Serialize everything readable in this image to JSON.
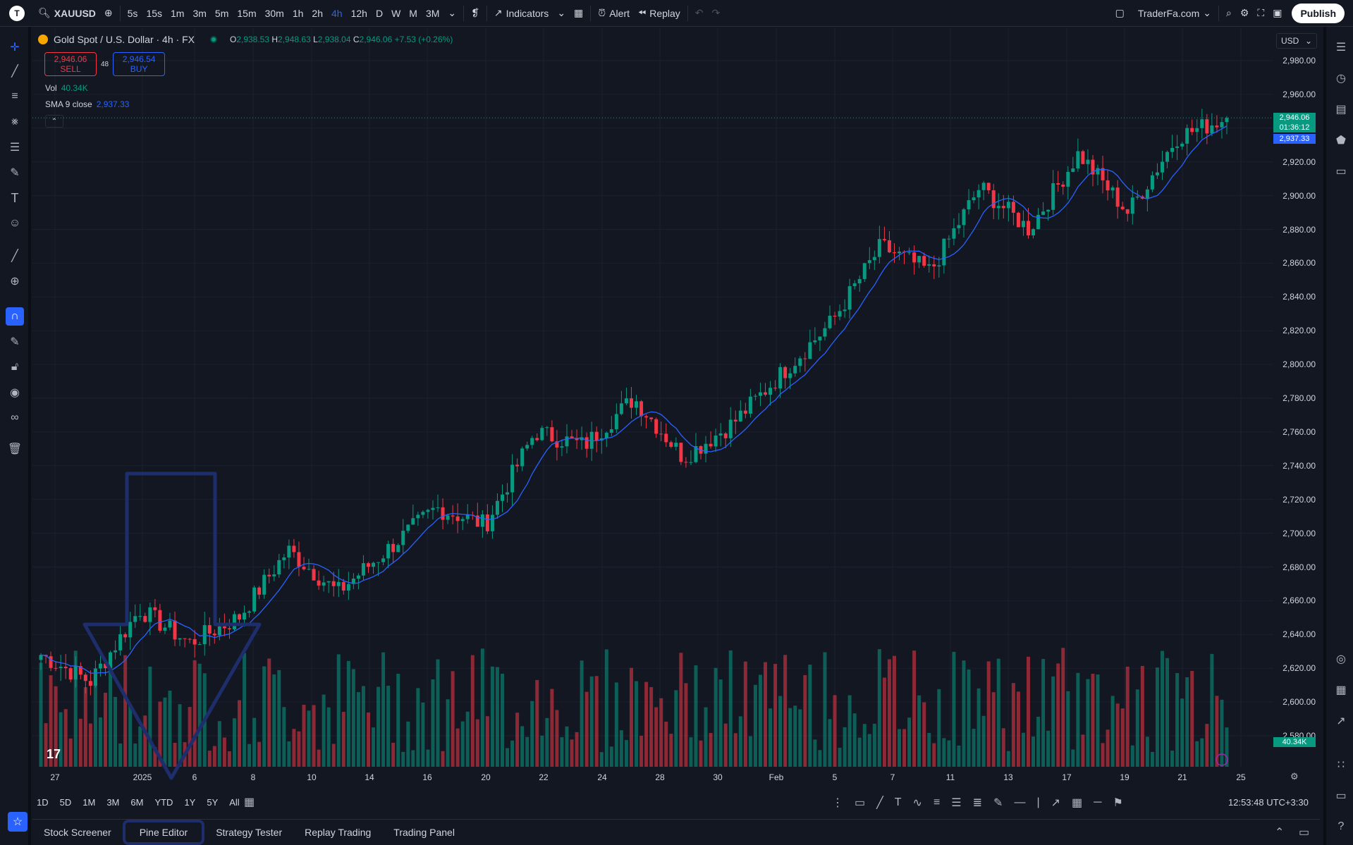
{
  "topbar": {
    "symbol": "XAUUSD",
    "timeframes": [
      "5s",
      "15s",
      "1m",
      "3m",
      "5m",
      "15m",
      "30m",
      "1h",
      "2h",
      "4h",
      "12h",
      "D",
      "W",
      "M",
      "3M"
    ],
    "active_timeframe": "4h",
    "indicators_label": "Indicators",
    "alert_label": "Alert",
    "replay_label": "Replay",
    "layout_name": "TraderFa.com",
    "publish_label": "Publish"
  },
  "legend": {
    "title": "Gold Spot / U.S. Dollar · 4h · FX",
    "o_label": "O",
    "o": "2,938.53",
    "h_label": "H",
    "h": "2,948.63",
    "l_label": "L",
    "l": "2,938.04",
    "c_label": "C",
    "c": "2,946.06",
    "change": "+7.53 (+0.26%)",
    "sell_price": "2,946.06",
    "sell_label": "SELL",
    "spread": "48",
    "buy_price": "2,946.54",
    "buy_label": "BUY",
    "vol_label": "Vol",
    "vol_value": "40.34K",
    "sma_label": "SMA 9 close",
    "sma_value": "2,937.33"
  },
  "price_axis": {
    "currency": "USD",
    "ticks": [
      "2,980.00",
      "2,960.00",
      "2,940.00",
      "2,920.00",
      "2,900.00",
      "2,880.00",
      "2,860.00",
      "2,840.00",
      "2,820.00",
      "2,800.00",
      "2,780.00",
      "2,760.00",
      "2,740.00",
      "2,720.00",
      "2,700.00",
      "2,680.00",
      "2,660.00",
      "2,640.00",
      "2,620.00",
      "2,600.00",
      "2,580.00"
    ],
    "last_price": "2,946.06",
    "countdown": "01:36:12",
    "sma_tag": "2,937.33",
    "vol_tag": "40.34K"
  },
  "time_axis": [
    "27",
    "2025",
    "6",
    "8",
    "10",
    "14",
    "16",
    "20",
    "22",
    "24",
    "28",
    "30",
    "Feb",
    "5",
    "7",
    "11",
    "13",
    "17",
    "19",
    "21",
    "25"
  ],
  "range_bar": [
    "1D",
    "5D",
    "1M",
    "3M",
    "6M",
    "YTD",
    "1Y",
    "5Y",
    "All"
  ],
  "clock": "12:53:48 UTC+3:30",
  "bottom_tabs": [
    "Stock Screener",
    "Pine Editor",
    "Strategy Tester",
    "Replay Trading",
    "Trading Panel"
  ],
  "colors": {
    "up": "#089981",
    "down": "#f23645",
    "sma": "#2962ff",
    "annotation": "#1e2d6b",
    "accent": "#2962ff"
  },
  "chart_data": {
    "type": "candlestick",
    "title": "Gold Spot / U.S. Dollar · 4h · FX",
    "x": [
      "27",
      "2025",
      "6",
      "8",
      "10",
      "14",
      "16",
      "20",
      "22",
      "24",
      "28",
      "30",
      "Feb",
      "5",
      "7",
      "11",
      "13",
      "17",
      "19",
      "21",
      "25"
    ],
    "close": [
      2628,
      2612,
      2655,
      2635,
      2650,
      2690,
      2665,
      2690,
      2715,
      2705,
      2760,
      2752,
      2780,
      2745,
      2765,
      2795,
      2825,
      2870,
      2855,
      2905,
      2880,
      2925,
      2890,
      2935,
      2946
    ],
    "ylim": [
      2570,
      2990
    ],
    "series": [
      {
        "name": "SMA 9 close",
        "last": 2937.33
      },
      {
        "name": "Vol",
        "last": "40.34K"
      }
    ]
  }
}
